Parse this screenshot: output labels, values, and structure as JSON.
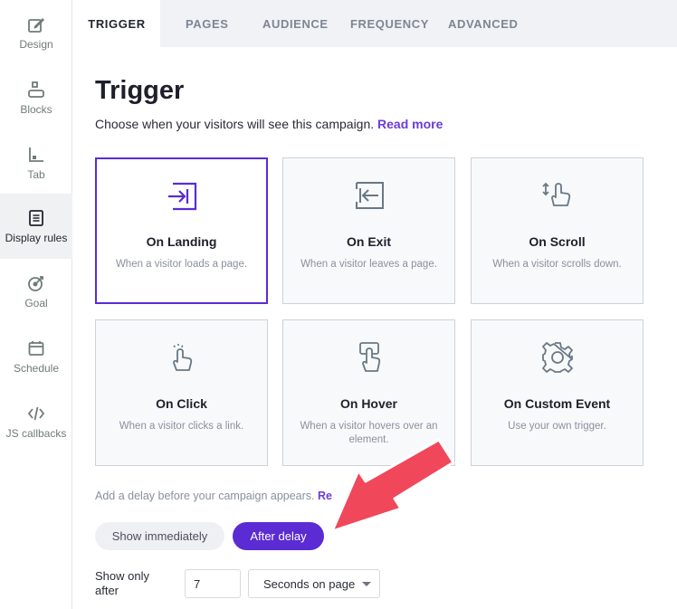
{
  "sidebar": {
    "items": [
      {
        "label": "Design",
        "icon": "design-icon"
      },
      {
        "label": "Blocks",
        "icon": "blocks-icon"
      },
      {
        "label": "Tab",
        "icon": "tab-icon"
      },
      {
        "label": "Display rules",
        "icon": "display-rules-icon",
        "active": true
      },
      {
        "label": "Goal",
        "icon": "goal-icon"
      },
      {
        "label": "Schedule",
        "icon": "calendar-icon"
      },
      {
        "label": "JS callbacks",
        "icon": "code-icon"
      }
    ]
  },
  "tabs": [
    {
      "label": "TRIGGER",
      "active": true
    },
    {
      "label": "PAGES"
    },
    {
      "label": "AUDIENCE"
    },
    {
      "label": "FREQUENCY"
    },
    {
      "label": "ADVANCED"
    }
  ],
  "main": {
    "title": "Trigger",
    "subtitle": "Choose when your visitors will see this campaign.",
    "read_more": "Read more",
    "cards": [
      {
        "title": "On Landing",
        "desc": "When a visitor loads a page.",
        "icon": "enter-icon",
        "selected": true
      },
      {
        "title": "On Exit",
        "desc": "When a visitor leaves a page.",
        "icon": "exit-icon"
      },
      {
        "title": "On Scroll",
        "desc": "When a visitor scrolls down.",
        "icon": "scroll-hand-icon"
      },
      {
        "title": "On Click",
        "desc": "When a visitor clicks a link.",
        "icon": "click-hand-icon"
      },
      {
        "title": "On Hover",
        "desc": "When a visitor hovers over an element.",
        "icon": "hover-hand-icon"
      },
      {
        "title": "On Custom Event",
        "desc": "Use your own trigger.",
        "icon": "gear-icon"
      }
    ],
    "delay_hint": "Add a delay before your campaign appears.",
    "delay_hint_link": "Re",
    "show_immediately": "Show immediately",
    "after_delay": "After delay",
    "show_only_after": "Show only after",
    "delay_value": "7",
    "delay_unit": "Seconds on page"
  },
  "colors": {
    "accent": "#5b2bd3",
    "annotation_arrow": "#f0475a",
    "sidebar_icon": "#6f7c75"
  }
}
